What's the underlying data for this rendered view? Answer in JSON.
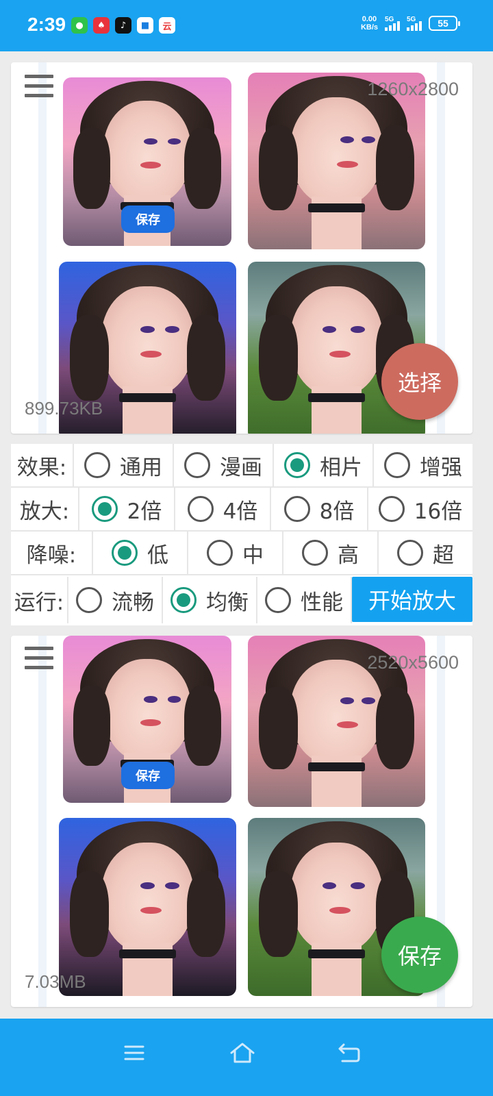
{
  "status_bar": {
    "time": "2:39",
    "notification_icons": [
      "wechat-icon",
      "game-app-icon",
      "tiktok-icon",
      "app-icon",
      "cloud-app-icon"
    ],
    "net_speed_value": "0.00",
    "net_speed_unit": "KB/s",
    "signal_1_label": "5G",
    "signal_2_label": "5G",
    "battery": "55"
  },
  "input_card": {
    "resolution": "1260x2800",
    "file_size": "899.73KB",
    "save_chip_label": "保存",
    "fab_label": "选择"
  },
  "options": {
    "rows": [
      {
        "label": "效果:",
        "options": [
          {
            "label": "通用",
            "selected": false
          },
          {
            "label": "漫画",
            "selected": false
          },
          {
            "label": "相片",
            "selected": true
          },
          {
            "label": "增强",
            "selected": false
          }
        ]
      },
      {
        "label": "放大:",
        "options": [
          {
            "label": "2倍",
            "selected": true
          },
          {
            "label": "4倍",
            "selected": false
          },
          {
            "label": "8倍",
            "selected": false
          },
          {
            "label": "16倍",
            "selected": false
          }
        ]
      },
      {
        "label": "降噪:",
        "options": [
          {
            "label": "低",
            "selected": true
          },
          {
            "label": "中",
            "selected": false
          },
          {
            "label": "高",
            "selected": false
          },
          {
            "label": "超",
            "selected": false
          }
        ]
      },
      {
        "label": "运行:",
        "options": [
          {
            "label": "流畅",
            "selected": false
          },
          {
            "label": "均衡",
            "selected": true
          },
          {
            "label": "性能",
            "selected": false
          }
        ]
      }
    ],
    "start_button_label": "开始放大"
  },
  "output_card": {
    "resolution": "2520x5600",
    "file_size": "7.03MB",
    "save_chip_label": "保存",
    "fab_label": "保存"
  },
  "colors": {
    "accent": "#1aa3f0",
    "radio_selected": "#199a7e",
    "select_fab": "#cd6b5f",
    "save_fab": "#3aaa4e"
  },
  "nav_bar": {
    "icons": [
      "menu-icon",
      "home-icon",
      "back-icon"
    ]
  }
}
